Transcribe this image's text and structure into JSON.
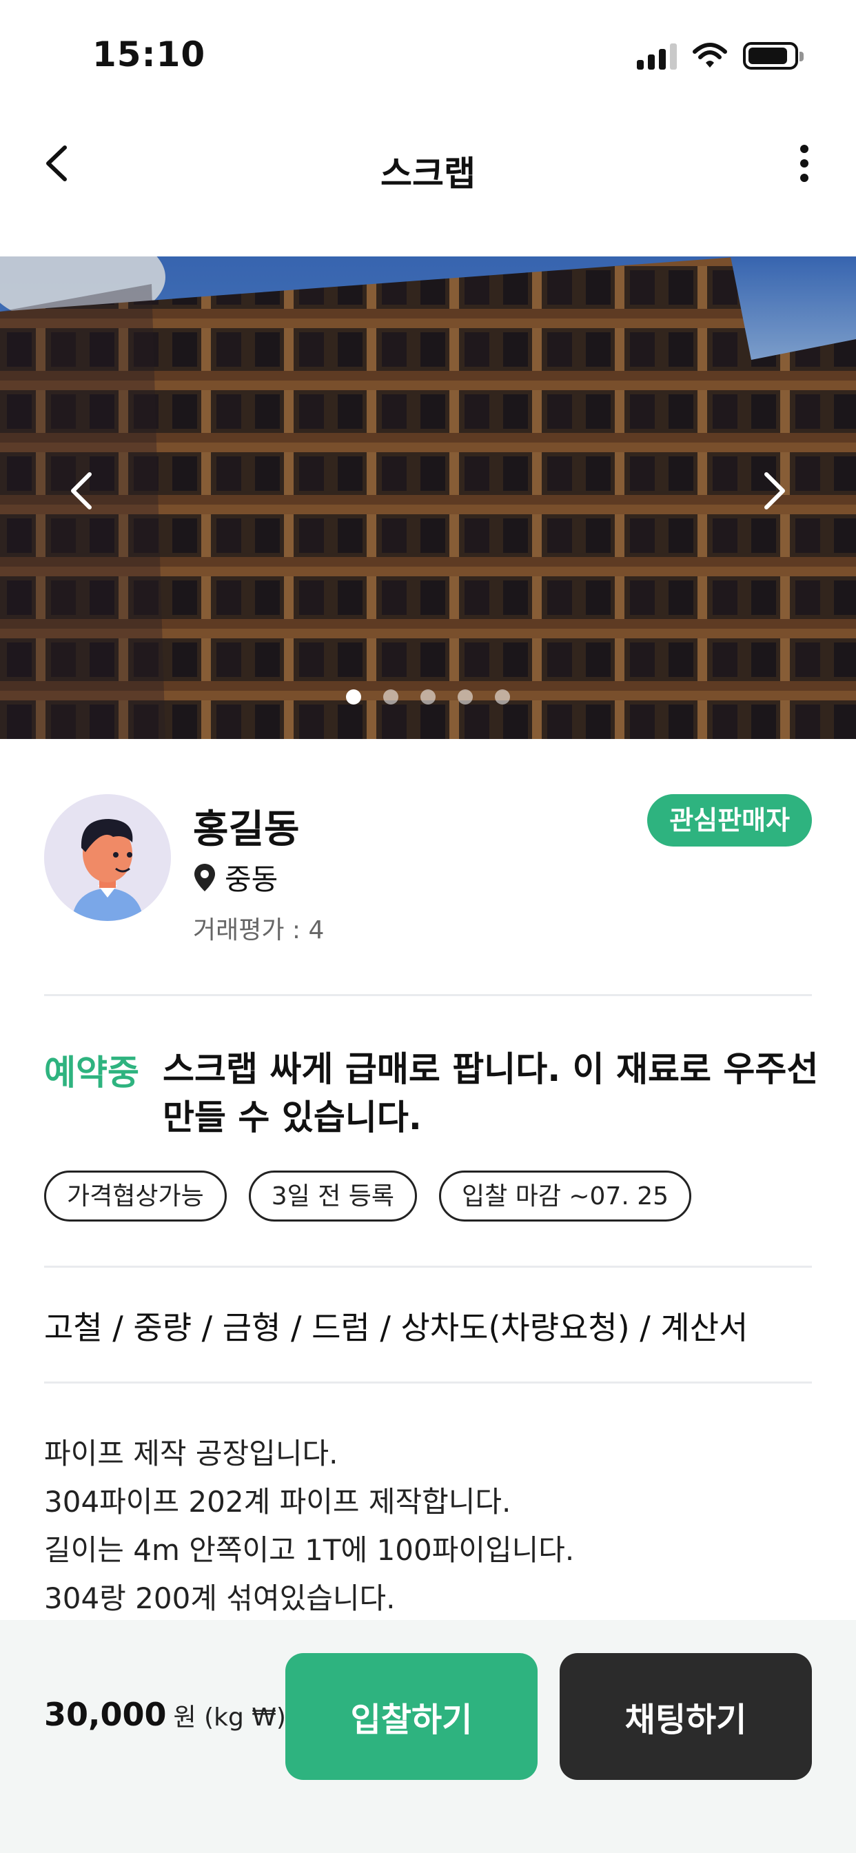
{
  "status_bar": {
    "time": "15:10"
  },
  "nav": {
    "title": "스크랩"
  },
  "carousel": {
    "total": 5,
    "active_index": 0
  },
  "seller": {
    "name": "홍길동",
    "location": "중동",
    "rating": "거래평가 : 4",
    "favorite_label": "관심판매자"
  },
  "listing": {
    "status": "예약중",
    "title": "스크랩 싸게 급매로 팝니다. 이 재료로 우주선 만들 수 있습니다.",
    "tags": [
      "가격협상가능",
      "3일 전 등록",
      "입찰 마감 ~07. 25"
    ],
    "specs": "고철 / 중량 / 금형 / 드럼 / 상차도(차량요청) / 계산서",
    "description": [
      "파이프 제작 공장입니다.",
      "304파이프 202계 파이프 제작합니다.",
      "길이는 4m 안쪽이고 1T에 100파이입니다.",
      "304랑 200계 섞여있습니다."
    ]
  },
  "bottom": {
    "price": "30,000",
    "unit": "원 (kg ₩)",
    "bid_label": "입찰하기",
    "chat_label": "채팅하기"
  },
  "colors": {
    "accent": "#2eb37f",
    "dark_button": "#2b2b2b"
  }
}
